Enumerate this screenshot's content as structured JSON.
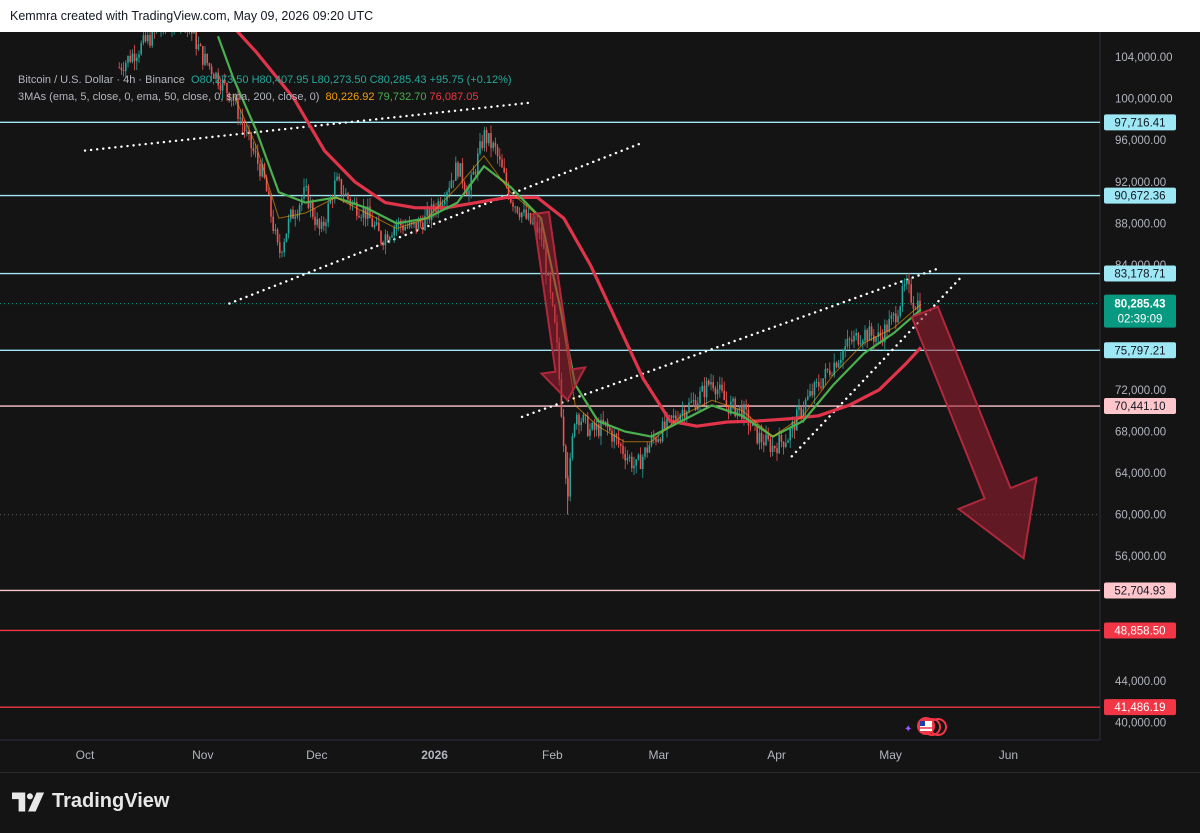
{
  "header": {
    "caption": "Kemmra created with TradingView.com, May 09, 2026 09:20 UTC"
  },
  "legend": {
    "symbol": "Bitcoin / U.S. Dollar · 4h · Binance",
    "open": "O80,273.50",
    "high": "H80,407.95",
    "low": "L80,273.50",
    "close": "C80,285.43",
    "change": "+95.75 (+0.12%)",
    "indicator": "3MAs (ema, 5, close, 0, ema, 50, close, 0, sma, 200, close, 0)",
    "ma1": "80,226.92",
    "ma2": "79,732.70",
    "ma3": "76,087.05"
  },
  "colors": {
    "background": "#141414",
    "candle_up": "#26a69a",
    "candle_down": "#ef5350",
    "ema_fast": "#f59e0b",
    "ema_mid": "#4caf50",
    "sma_slow": "#e0344a",
    "level_cyan": "#9ee8f5",
    "level_pink": "#ffc7cc",
    "level_red": "#f23645",
    "price_tag": "#089981"
  },
  "chart_data": {
    "type": "line",
    "title": "Bitcoin / U.S. Dollar · 4h · Binance",
    "y_axis": {
      "range": [
        40000,
        104000
      ],
      "tick_labels": [
        "104,000.00",
        "100,000.00",
        "96,000.00",
        "92,000.00",
        "88,000.00",
        "84,000.00",
        "72,000.00",
        "68,000.00",
        "64,000.00",
        "60,000.00",
        "56,000.00",
        "44,000.00",
        "40,000.00"
      ]
    },
    "x_axis": {
      "tick_labels": [
        "Oct",
        "Nov",
        "Dec",
        "2026",
        "Feb",
        "Mar",
        "Apr",
        "May",
        "Jun"
      ]
    },
    "horizontal_levels": [
      {
        "value": 97716.41,
        "label": "97,716.41",
        "style": "cyan"
      },
      {
        "value": 90672.36,
        "label": "90,672.36",
        "style": "cyan"
      },
      {
        "value": 83178.71,
        "label": "83,178.71",
        "style": "cyan"
      },
      {
        "value": 75797.21,
        "label": "75,797.21",
        "style": "cyan"
      },
      {
        "value": 70441.1,
        "label": "70,441.10",
        "style": "pink"
      },
      {
        "value": 52704.93,
        "label": "52,704.93",
        "style": "pink"
      },
      {
        "value": 48858.5,
        "label": "48,858.50",
        "style": "red"
      },
      {
        "value": 41486.19,
        "label": "41,486.19",
        "style": "red"
      }
    ],
    "current_price": {
      "value": 80285.43,
      "label": "80,285.43",
      "countdown": "02:39:09"
    },
    "price_series": [
      {
        "t": "Oct 10",
        "v": 103000
      },
      {
        "t": "Oct 20",
        "v": 106500
      },
      {
        "t": "Oct 27",
        "v": 108000
      },
      {
        "t": "Nov 01",
        "v": 104000
      },
      {
        "t": "Nov 05",
        "v": 102000
      },
      {
        "t": "Nov 09",
        "v": 100000
      },
      {
        "t": "Nov 13",
        "v": 96000
      },
      {
        "t": "Nov 17",
        "v": 92500
      },
      {
        "t": "Nov 21",
        "v": 85000
      },
      {
        "t": "Nov 24",
        "v": 88500
      },
      {
        "t": "Nov 28",
        "v": 91000
      },
      {
        "t": "Dec 02",
        "v": 87000
      },
      {
        "t": "Dec 06",
        "v": 92000
      },
      {
        "t": "Dec 10",
        "v": 90000
      },
      {
        "t": "Dec 14",
        "v": 89000
      },
      {
        "t": "Dec 18",
        "v": 86500
      },
      {
        "t": "Dec 22",
        "v": 88000
      },
      {
        "t": "Dec 26",
        "v": 87500
      },
      {
        "t": "Dec 30",
        "v": 88500
      },
      {
        "t": "Jan 03",
        "v": 90500
      },
      {
        "t": "Jan 07",
        "v": 93500
      },
      {
        "t": "Jan 10",
        "v": 91000
      },
      {
        "t": "Jan 14",
        "v": 96500
      },
      {
        "t": "Jan 17",
        "v": 95000
      },
      {
        "t": "Jan 21",
        "v": 90500
      },
      {
        "t": "Jan 25",
        "v": 88500
      },
      {
        "t": "Jan 29",
        "v": 87000
      },
      {
        "t": "Feb 02",
        "v": 77000
      },
      {
        "t": "Feb 05",
        "v": 62000
      },
      {
        "t": "Feb 07",
        "v": 70000
      },
      {
        "t": "Feb 11",
        "v": 68000
      },
      {
        "t": "Feb 15",
        "v": 68500
      },
      {
        "t": "Feb 19",
        "v": 66500
      },
      {
        "t": "Feb 23",
        "v": 64500
      },
      {
        "t": "Feb 27",
        "v": 67000
      },
      {
        "t": "Mar 03",
        "v": 68500
      },
      {
        "t": "Mar 07",
        "v": 70000
      },
      {
        "t": "Mar 11",
        "v": 71000
      },
      {
        "t": "Mar 15",
        "v": 73000
      },
      {
        "t": "Mar 19",
        "v": 70500
      },
      {
        "t": "Mar 23",
        "v": 70000
      },
      {
        "t": "Mar 27",
        "v": 67500
      },
      {
        "t": "Mar 31",
        "v": 66500
      },
      {
        "t": "Apr 04",
        "v": 67500
      },
      {
        "t": "Apr 08",
        "v": 70500
      },
      {
        "t": "Apr 12",
        "v": 72500
      },
      {
        "t": "Apr 16",
        "v": 74500
      },
      {
        "t": "Apr 20",
        "v": 76500
      },
      {
        "t": "Apr 24",
        "v": 77500
      },
      {
        "t": "Apr 28",
        "v": 77000
      },
      {
        "t": "May 02",
        "v": 79000
      },
      {
        "t": "May 05",
        "v": 82000
      },
      {
        "t": "May 07",
        "v": 80500
      },
      {
        "t": "May 09",
        "v": 80285
      }
    ],
    "ma_fast": [
      {
        "t": "Nov 09",
        "v": 100500
      },
      {
        "t": "Nov 15",
        "v": 95500
      },
      {
        "t": "Nov 21",
        "v": 88500
      },
      {
        "t": "Nov 28",
        "v": 89000
      },
      {
        "t": "Dec 06",
        "v": 90500
      },
      {
        "t": "Dec 14",
        "v": 89000
      },
      {
        "t": "Dec 22",
        "v": 87500
      },
      {
        "t": "Dec 30",
        "v": 88500
      },
      {
        "t": "Jan 07",
        "v": 91500
      },
      {
        "t": "Jan 14",
        "v": 94500
      },
      {
        "t": "Jan 21",
        "v": 91000
      },
      {
        "t": "Jan 29",
        "v": 88500
      },
      {
        "t": "Feb 03",
        "v": 80000
      },
      {
        "t": "Feb 07",
        "v": 70500
      },
      {
        "t": "Feb 13",
        "v": 68500
      },
      {
        "t": "Feb 20",
        "v": 67000
      },
      {
        "t": "Feb 27",
        "v": 67000
      },
      {
        "t": "Mar 07",
        "v": 69500
      },
      {
        "t": "Mar 15",
        "v": 71000
      },
      {
        "t": "Mar 23",
        "v": 70000
      },
      {
        "t": "Mar 31",
        "v": 67500
      },
      {
        "t": "Apr 08",
        "v": 69500
      },
      {
        "t": "Apr 16",
        "v": 73500
      },
      {
        "t": "Apr 24",
        "v": 76500
      },
      {
        "t": "May 02",
        "v": 78000
      },
      {
        "t": "May 09",
        "v": 80227
      }
    ],
    "ma_mid": [
      {
        "t": "Nov 05",
        "v": 106000
      },
      {
        "t": "Nov 09",
        "v": 102000
      },
      {
        "t": "Nov 15",
        "v": 97000
      },
      {
        "t": "Nov 21",
        "v": 91000
      },
      {
        "t": "Nov 28",
        "v": 90000
      },
      {
        "t": "Dec 06",
        "v": 90500
      },
      {
        "t": "Dec 14",
        "v": 89500
      },
      {
        "t": "Dec 22",
        "v": 88000
      },
      {
        "t": "Dec 30",
        "v": 88500
      },
      {
        "t": "Jan 07",
        "v": 90000
      },
      {
        "t": "Jan 14",
        "v": 93500
      },
      {
        "t": "Jan 21",
        "v": 91500
      },
      {
        "t": "Jan 29",
        "v": 88500
      },
      {
        "t": "Feb 03",
        "v": 80000
      },
      {
        "t": "Feb 07",
        "v": 72500
      },
      {
        "t": "Feb 13",
        "v": 69000
      },
      {
        "t": "Feb 20",
        "v": 68000
      },
      {
        "t": "Feb 27",
        "v": 67500
      },
      {
        "t": "Mar 07",
        "v": 69000
      },
      {
        "t": "Mar 15",
        "v": 70500
      },
      {
        "t": "Mar 23",
        "v": 69500
      },
      {
        "t": "Mar 31",
        "v": 67500
      },
      {
        "t": "Apr 08",
        "v": 69000
      },
      {
        "t": "Apr 16",
        "v": 72500
      },
      {
        "t": "Apr 24",
        "v": 75500
      },
      {
        "t": "May 02",
        "v": 77500
      },
      {
        "t": "May 09",
        "v": 79733
      }
    ],
    "ma_slow": [
      {
        "t": "Nov 05",
        "v": 108500
      },
      {
        "t": "Nov 15",
        "v": 104500
      },
      {
        "t": "Nov 25",
        "v": 100000
      },
      {
        "t": "Dec 03",
        "v": 95000
      },
      {
        "t": "Dec 11",
        "v": 92000
      },
      {
        "t": "Dec 19",
        "v": 90000
      },
      {
        "t": "Dec 27",
        "v": 89500
      },
      {
        "t": "Jan 04",
        "v": 89500
      },
      {
        "t": "Jan 12",
        "v": 90000
      },
      {
        "t": "Jan 20",
        "v": 90500
      },
      {
        "t": "Jan 28",
        "v": 90500
      },
      {
        "t": "Feb 04",
        "v": 88500
      },
      {
        "t": "Feb 11",
        "v": 84000
      },
      {
        "t": "Feb 18",
        "v": 78500
      },
      {
        "t": "Feb 25",
        "v": 73000
      },
      {
        "t": "Mar 04",
        "v": 69000
      },
      {
        "t": "Mar 11",
        "v": 68500
      },
      {
        "t": "Mar 19",
        "v": 68900
      },
      {
        "t": "Mar 27",
        "v": 69000
      },
      {
        "t": "Apr 04",
        "v": 69200
      },
      {
        "t": "Apr 12",
        "v": 69500
      },
      {
        "t": "Apr 20",
        "v": 70500
      },
      {
        "t": "Apr 28",
        "v": 72000
      },
      {
        "t": "May 05",
        "v": 74500
      },
      {
        "t": "May 09",
        "v": 76087
      }
    ],
    "annotations": [
      {
        "kind": "dotted-trendline",
        "from": {
          "t": "Oct 01",
          "v": 95000
        },
        "to": {
          "t": "Jan 26",
          "v": 99600
        }
      },
      {
        "kind": "dotted-trendline",
        "from": {
          "t": "Nov 08",
          "v": 80300
        },
        "to": {
          "t": "Feb 25",
          "v": 95800
        }
      },
      {
        "kind": "dotted-trendline",
        "from": {
          "t": "Jan 24",
          "v": 69400
        },
        "to": {
          "t": "May 13",
          "v": 83600
        }
      },
      {
        "kind": "dotted-trendline",
        "from": {
          "t": "Apr 05",
          "v": 65600
        },
        "to": {
          "t": "May 20",
          "v": 83000
        }
      },
      {
        "kind": "arrow-down",
        "from": {
          "t": "Jan 29",
          "v": 89000
        },
        "to": {
          "t": "Feb 05",
          "v": 71000
        }
      },
      {
        "kind": "arrow-down",
        "from": {
          "t": "May 10",
          "v": 79500
        },
        "to": {
          "t": "Jun 05",
          "v": 55800
        }
      }
    ]
  },
  "footer": {
    "brand": "TradingView"
  }
}
